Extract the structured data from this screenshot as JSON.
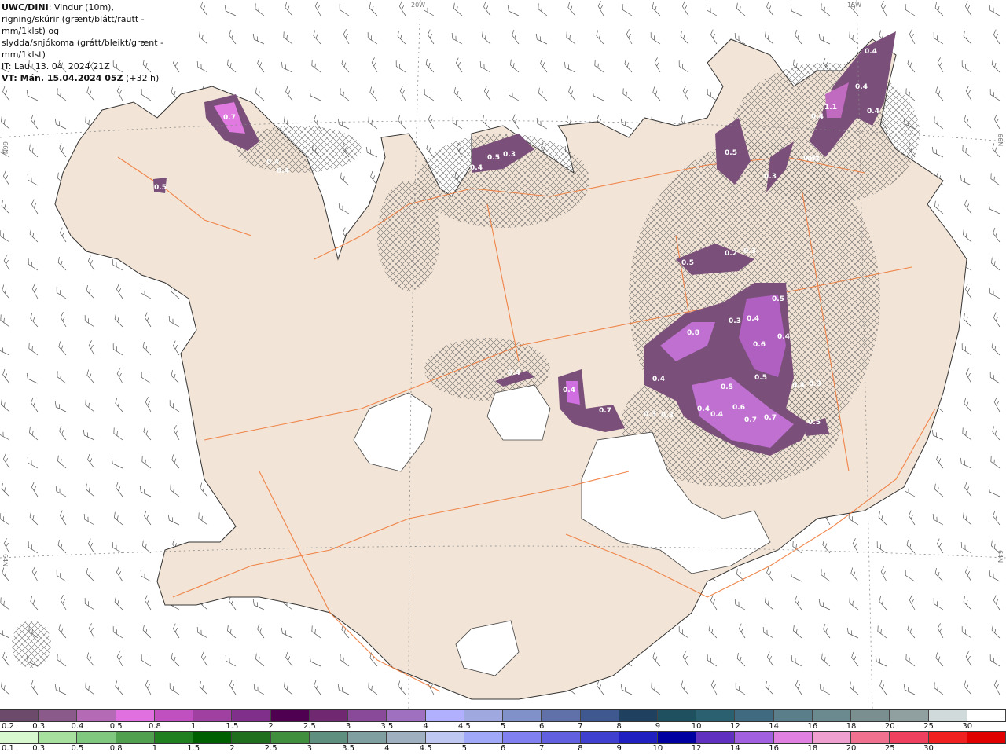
{
  "header": {
    "model": "UWC/DINI",
    "line1": ": Vindur (10m),",
    "line2": "rigning/skúrir (grænt/blátt/rautt - mm/1klst) og",
    "line3": "slydda/snjókoma (grátt/bleikt/grænt - mm/1klst)",
    "issue_time": "IT: Lau. 13. 04. 2024 21Z",
    "valid_label": "VT: Mán. 15.04.2024 05Z",
    "valid_offset": " (+32 h)"
  },
  "graticule": {
    "top_left": "20W",
    "top_right": "15W",
    "left_upper": "66N",
    "right_upper": "66N",
    "left_lower": "64N",
    "right_lower": "64N"
  },
  "precip_labels": [
    "0.7",
    "0.4",
    "0.4",
    "0.5",
    "0.4",
    "0.3",
    "0.5",
    "0.3",
    "0.4",
    "1.1",
    "0.4",
    "0.4",
    "0.4",
    "0.4",
    "0.3",
    "0.2",
    "0.3",
    "0.5",
    "0.5",
    "0.8",
    "0.3",
    "0.4",
    "0.4",
    "0.6",
    "0.4",
    "0.5",
    "0.4",
    "0.3",
    "0.5",
    "0.6",
    "0.4",
    "0.7",
    "0.7",
    "0.3",
    "0.5",
    "0.3",
    "0.4",
    "0.5",
    "0.7",
    "0.4",
    "0.4"
  ],
  "snow_scale": {
    "labels": [
      "0.2",
      "0.3",
      "0.4",
      "0.5",
      "0.8",
      "1",
      "1.5",
      "2",
      "2.5",
      "3",
      "3.5",
      "4",
      "4.5",
      "5",
      "6",
      "7",
      "8",
      "9",
      "10",
      "12",
      "14",
      "16",
      "18",
      "20",
      "25",
      "30"
    ],
    "colors": [
      "#6b4a6b",
      "#8a5a8a",
      "#b56ab5",
      "#e070e0",
      "#c050c0",
      "#a040a0",
      "#80308a",
      "#500050",
      "#702870",
      "#8a4a9a",
      "#a070c0",
      "#b0b0ff",
      "#a0a8e0",
      "#8090c8",
      "#6070a8",
      "#405890",
      "#204060",
      "#1f5060",
      "#2a6070",
      "#406a80",
      "#5a7f8a",
      "#6a8a90",
      "#7a9090",
      "#90a0a0",
      "#d0dada",
      "#ffffff"
    ]
  },
  "rain_scale": {
    "labels": [
      "0.1",
      "0.3",
      "0.5",
      "0.8",
      "1",
      "1.5",
      "2",
      "2.5",
      "3",
      "3.5",
      "4",
      "4.5",
      "5",
      "6",
      "7",
      "8",
      "9",
      "10",
      "12",
      "14",
      "16",
      "18",
      "20",
      "25",
      "30"
    ],
    "colors": [
      "#d8f8d0",
      "#a8e0a0",
      "#80c880",
      "#50a050",
      "#208020",
      "#006000",
      "#1f6f1f",
      "#3f8f3f",
      "#5f8f7f",
      "#7f9fa0",
      "#9fb0c0",
      "#bfc8f0",
      "#a0a8f8",
      "#8080f0",
      "#6060e0",
      "#4040d0",
      "#2020c0",
      "#0000a0",
      "#6030c0",
      "#a060e0",
      "#e080e0",
      "#f0a0d0",
      "#f07090",
      "#f04060",
      "#f02020",
      "#e00000"
    ]
  }
}
